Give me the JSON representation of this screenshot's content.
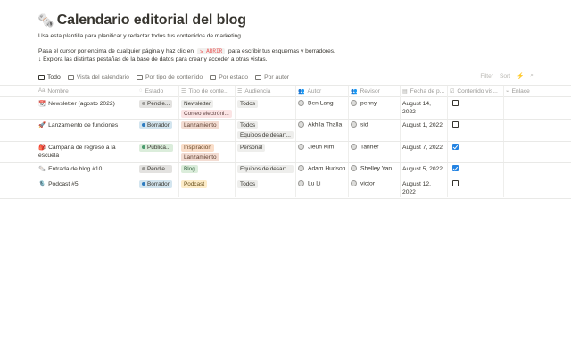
{
  "page": {
    "icon": "newspaper-icon",
    "title": "Calendario editorial del blog",
    "description": "Usa esta plantilla para planificar y redactar todos tus contenidos de marketing.",
    "hint_before": "Pasa el cursor por encima de cualquier página y haz clic en",
    "hint_code": "ABRIR",
    "hint_after": "para escribir tus esquemas y borradores.",
    "hint2": "↓ Explora las distintas pestañas de la base de datos para crear y acceder a otras vistas."
  },
  "tabs": [
    {
      "label": "Todo",
      "active": true
    },
    {
      "label": "Vista del calendario",
      "active": false
    },
    {
      "label": "Por tipo de contenido",
      "active": false
    },
    {
      "label": "Por estado",
      "active": false
    },
    {
      "label": "Por autor",
      "active": false
    }
  ],
  "toolbar": {
    "filter": "Filter",
    "sort": "Sort",
    "automation": "⚡",
    "search": "⌕"
  },
  "columns": [
    "Nombre",
    "Estado",
    "Tipo de conte...",
    "Audiencia",
    "Autor",
    "Revisor",
    "Fecha de p...",
    "Contenido vis...",
    "Enlace"
  ],
  "column_icons": [
    "Aa",
    "◌",
    "☰",
    "☰",
    "👥",
    "👥",
    "▤",
    "☑",
    "⌁"
  ],
  "rows": [
    {
      "emoji": "📆",
      "name": "Newsletter (agosto 2022)",
      "name2": "",
      "status": "Pendie...",
      "status_color": "#9b9a97",
      "status_bg": "#e3e2e0",
      "types": [
        {
          "label": "Newsletter",
          "bg": "#eeeeec",
          "fg": "#37352f"
        },
        {
          "label": "Correo electróni...",
          "bg": "#fbe4e4",
          "fg": "#5d3f3f"
        }
      ],
      "audience": [
        "Todos"
      ],
      "author": "Ben Lang",
      "reviewer": "penny",
      "date": "August 14,",
      "date2": "2022",
      "visible": false
    },
    {
      "emoji": "🚀",
      "name": "Lanzamiento de funciones",
      "name2": "",
      "status": "Borrador",
      "status_color": "#2e7cc1",
      "status_bg": "#d3e5ef",
      "types": [
        {
          "label": "Lanzamiento",
          "bg": "#f3dcd2",
          "fg": "#5d3f30"
        }
      ],
      "audience": [
        "Todos",
        "Equipos de desarr..."
      ],
      "author": "Akhila Thalla",
      "reviewer": "sid",
      "date": "August 1, 2022",
      "date2": "",
      "visible": false
    },
    {
      "emoji": "🎒",
      "name": "Campaña de regreso a la",
      "name2": "escuela",
      "status": "Publica...",
      "status_color": "#4a9b6e",
      "status_bg": "#dbeddb",
      "types": [
        {
          "label": "Inspiración",
          "bg": "#fadec9",
          "fg": "#6b4a2a"
        },
        {
          "label": "Lanzamiento",
          "bg": "#f3dcd2",
          "fg": "#5d3f30"
        }
      ],
      "audience": [
        "Personal"
      ],
      "author": "Jieun Kim",
      "reviewer": "Tanner",
      "date": "August 7, 2022",
      "date2": "",
      "visible": true
    },
    {
      "emoji": "🗞️",
      "name": "Entrada de blog #10",
      "name2": "",
      "status": "Pendie...",
      "status_color": "#9b9a97",
      "status_bg": "#e3e2e0",
      "types": [
        {
          "label": "Blog",
          "bg": "#dbeddb",
          "fg": "#2c5d3a"
        }
      ],
      "audience": [
        "Equipos de desarr..."
      ],
      "author": "Adam Hudson",
      "reviewer": "Shelley Yan",
      "date": "August 5, 2022",
      "date2": "",
      "visible": true
    },
    {
      "emoji": "🎙️",
      "name": "Podcast #5",
      "name2": "",
      "status": "Borrador",
      "status_color": "#2e7cc1",
      "status_bg": "#d3e5ef",
      "types": [
        {
          "label": "Podcast",
          "bg": "#fdecc8",
          "fg": "#6b5320"
        }
      ],
      "audience": [
        "Todos"
      ],
      "author": "Lu Li",
      "reviewer": "victor",
      "date": "August 12,",
      "date2": "2022",
      "visible": false
    }
  ]
}
